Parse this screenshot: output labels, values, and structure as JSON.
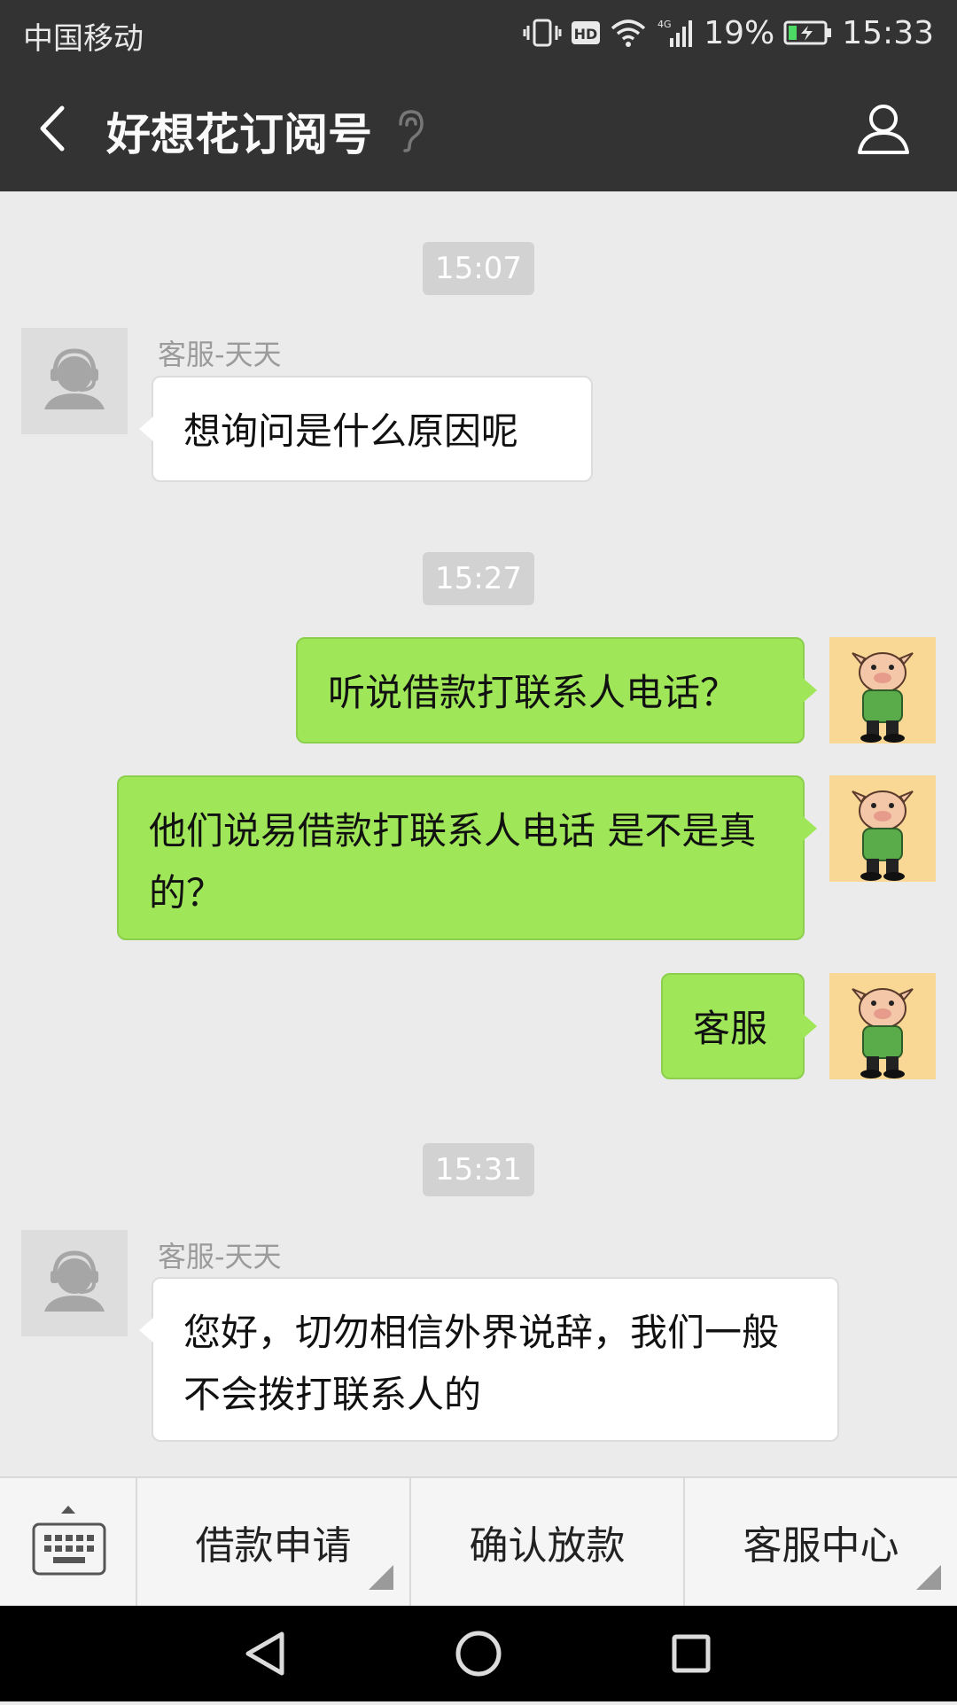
{
  "status_bar": {
    "carrier": "中国移动",
    "network": "4G",
    "battery": "19%",
    "time": "15:33",
    "icons": [
      "vibrate-icon",
      "hd-icon",
      "wifi-icon",
      "signal-icon",
      "battery-icon"
    ]
  },
  "nav": {
    "title": "好想花订阅号",
    "icons": [
      "back-arrow-icon",
      "earpiece-icon",
      "profile-icon"
    ]
  },
  "chat": {
    "times": [
      "15:07",
      "15:27",
      "15:31"
    ],
    "agent_name": "客服-天天",
    "messages": [
      {
        "from": "agent",
        "text": "想询问是什么原因呢"
      },
      {
        "from": "me",
        "text": "听说借款打联系人电话？"
      },
      {
        "from": "me",
        "text": "他们说易借款打联系人电话  是不是真的？"
      },
      {
        "from": "me",
        "text": "客服"
      },
      {
        "from": "agent",
        "text": "您好，切勿相信外界说辞，我们一般不会拨打联系人的"
      }
    ]
  },
  "menu": {
    "items": [
      "借款申请",
      "确认放款",
      "客服中心"
    ],
    "icons": [
      "keyboard-icon"
    ]
  },
  "colors": {
    "bar": "#333333",
    "background": "#ebebeb",
    "out_bubble": "#9fe658",
    "in_bubble": "#ffffff",
    "time_pill": "#d2d2d2"
  }
}
